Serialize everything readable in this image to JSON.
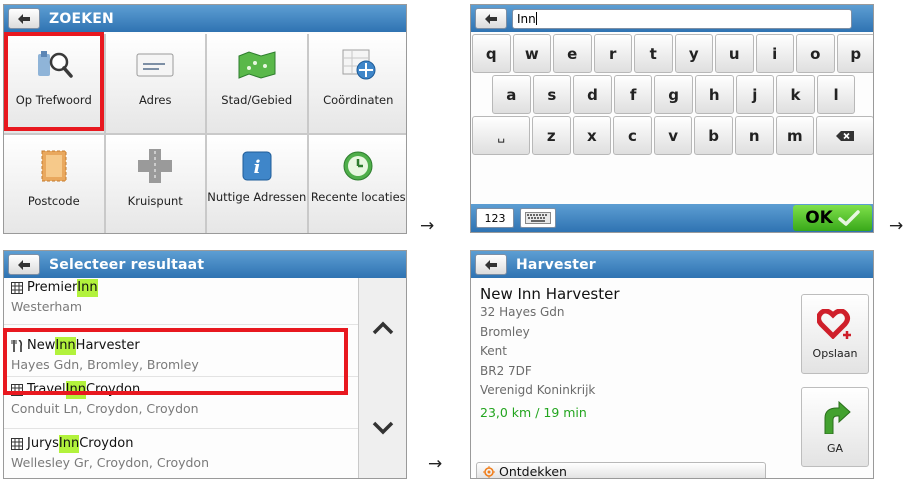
{
  "search_screen": {
    "title": "ZOEKEN",
    "tiles": [
      {
        "label": "Op Trefwoord",
        "icon": "keyword-search-icon"
      },
      {
        "label": "Adres",
        "icon": "address-card-icon"
      },
      {
        "label": "Stad/Gebied",
        "icon": "city-map-icon"
      },
      {
        "label": "Coördinaten",
        "icon": "coordinates-icon"
      },
      {
        "label": "Postcode",
        "icon": "postcode-stamp-icon"
      },
      {
        "label": "Kruispunt",
        "icon": "intersection-icon"
      },
      {
        "label": "Nuttige Adressen",
        "icon": "info-icon"
      },
      {
        "label": "Recente locaties",
        "icon": "clock-icon"
      }
    ],
    "highlighted": "Op Trefwoord"
  },
  "keyboard_screen": {
    "input_value": "Inn",
    "rows": [
      [
        "q",
        "w",
        "e",
        "r",
        "t",
        "y",
        "u",
        "i",
        "o",
        "p"
      ],
      [
        "a",
        "s",
        "d",
        "f",
        "g",
        "h",
        "j",
        "k",
        "l"
      ],
      [
        "␣",
        "z",
        "x",
        "c",
        "v",
        "b",
        "n",
        "m",
        "⌫"
      ]
    ],
    "mode_label": "123",
    "ok_label": "OK"
  },
  "results_screen": {
    "title": "Selecteer resultaat",
    "results": [
      {
        "pre": "Premier ",
        "match": "Inn",
        "post": "",
        "sub": "Westerham",
        "icon": "building-icon"
      },
      {
        "pre": "New ",
        "match": "Inn",
        "post": " Harvester",
        "sub": "Hayes Gdn, Bromley, Bromley",
        "icon": "restaurant-icon"
      },
      {
        "pre": "Travel ",
        "match": "Inn",
        "post": " Croydon",
        "sub": "Conduit Ln, Croydon, Croydon",
        "icon": "building-icon"
      },
      {
        "pre": "Jurys ",
        "match": "Inn",
        "post": " Croydon",
        "sub": "Wellesley Gr, Croydon, Croydon",
        "icon": "building-icon"
      }
    ]
  },
  "detail_screen": {
    "title": "Harvester",
    "name": "New Inn Harvester",
    "address_lines": [
      "32 Hayes Gdn",
      "Bromley",
      "Kent",
      "BR2 7DF",
      "Verenigd Koninkrijk"
    ],
    "distance": "23,0 km / 19 min",
    "explore_label": "Ontdekken",
    "save_label": "Opslaan",
    "go_label": "GA"
  },
  "flow_arrows": [
    "→",
    "→",
    "→"
  ],
  "colors": {
    "titlebar": "#3a80c0",
    "highlight_frame": "#e8181f",
    "match_highlight": "#b2f23c",
    "ok_button": "#4cbf26",
    "distance_text": "#23a51f"
  }
}
